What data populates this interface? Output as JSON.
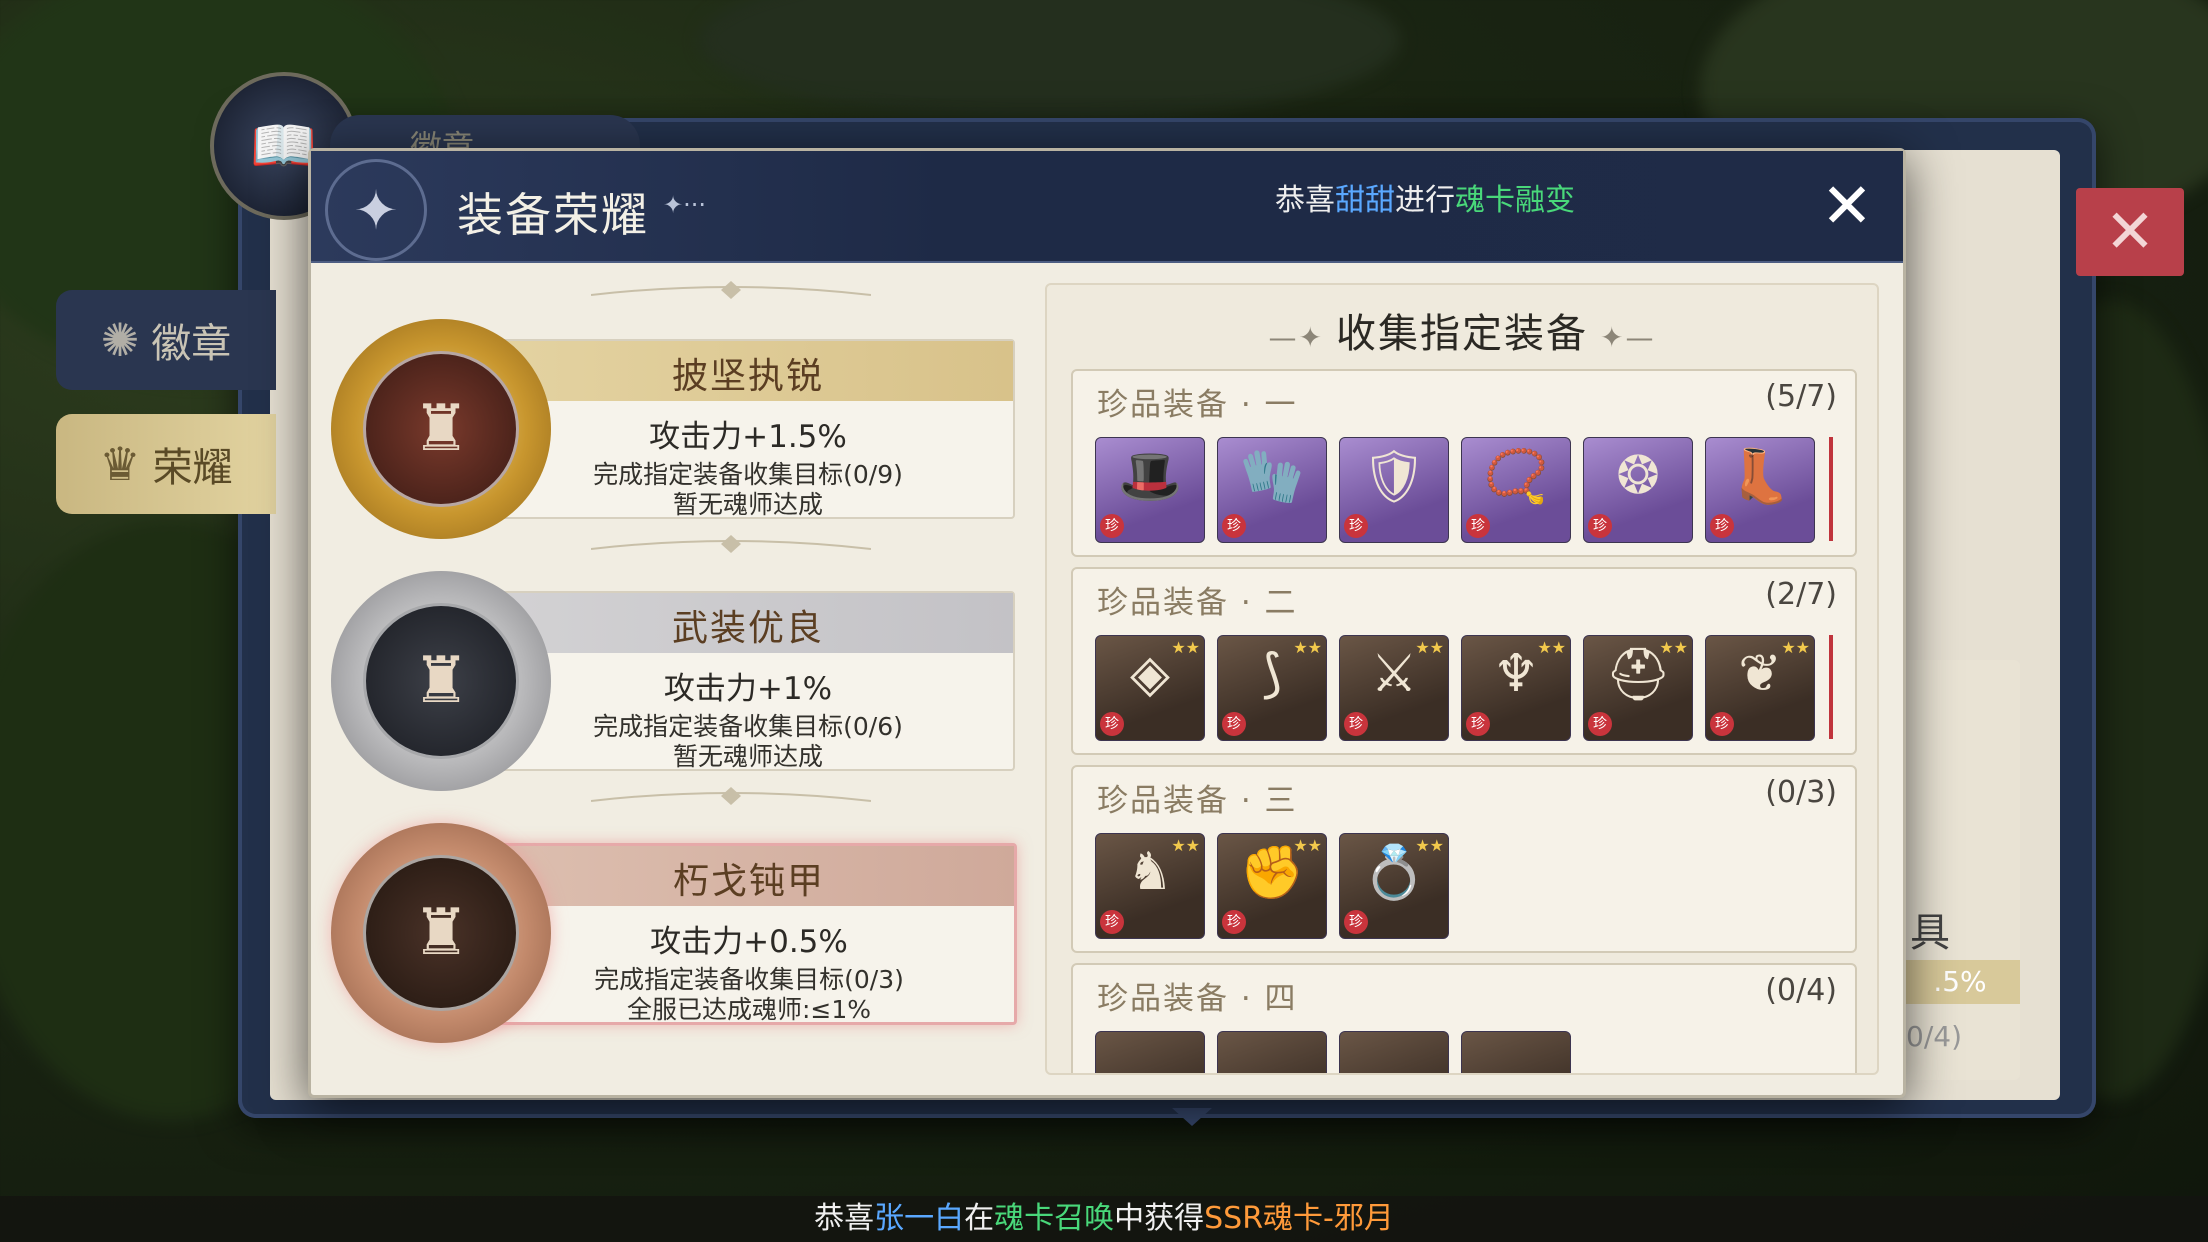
{
  "background_tabs": {
    "top_tab": "徽章",
    "side_badge": "徽章",
    "side_honor": "荣耀",
    "side_peek_text": "具",
    "side_peek_percent": ".5%",
    "side_peek_progress": "0/4)"
  },
  "modal": {
    "title": "装备荣耀",
    "title_ornament": "✦···",
    "notice": {
      "prefix": "恭喜",
      "player": "甜甜",
      "action": "进行",
      "event": "魂卡融变"
    },
    "close_icon": "✕"
  },
  "tiers": [
    {
      "name": "披坚执锐",
      "bonus": "攻击力+1.5%",
      "goal": "完成指定装备收集目标(0/9)",
      "status": "暂无魂师达成"
    },
    {
      "name": "武装优良",
      "bonus": "攻击力+1%",
      "goal": "完成指定装备收集目标(0/6)",
      "status": "暂无魂师达成"
    },
    {
      "name": "朽戈钝甲",
      "bonus": "攻击力+0.5%",
      "goal": "完成指定装备收集目标(0/3)",
      "status": "全服已达成魂师:≤1%"
    }
  ],
  "collection": {
    "title": "收集指定装备",
    "sets": [
      {
        "name": "珍品装备 · 一",
        "count": "(5/7)"
      },
      {
        "name": "珍品装备 · 二",
        "count": "(2/7)"
      },
      {
        "name": "珍品装备 · 三",
        "count": "(0/3)"
      },
      {
        "name": "珍品装备 · 四",
        "count": "(0/4)"
      }
    ],
    "rare_tag": "珍",
    "stars": "★★"
  },
  "broadcast": {
    "prefix": "恭喜",
    "player": "张一白",
    "at": "在",
    "event": "魂卡召唤",
    "got": "中获得",
    "reward": "SSR魂卡-邪月"
  }
}
